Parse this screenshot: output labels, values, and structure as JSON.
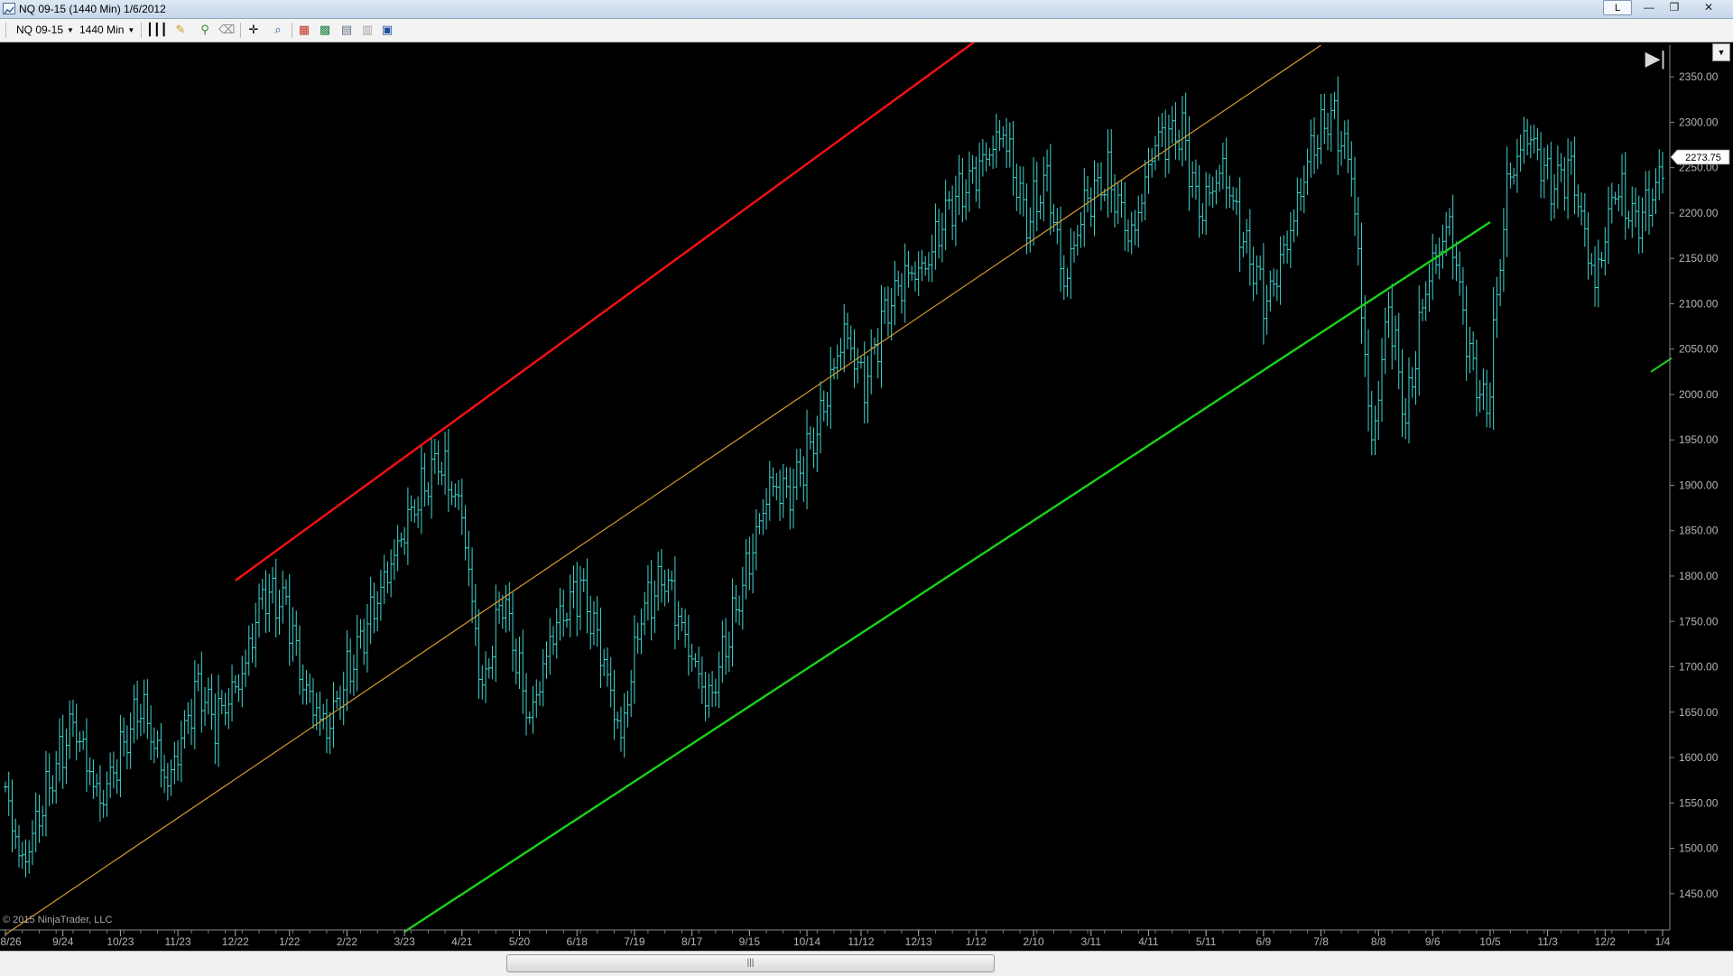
{
  "window": {
    "title": "NQ 09-15 (1440 Min)  1/6/2012",
    "link_label": "L",
    "minimize_glyph": "—",
    "maximize_glyph": "❐",
    "close_glyph": "✕"
  },
  "toolbar": {
    "instrument": "NQ 09-15",
    "interval": "1440 Min",
    "icons": [
      "bar-type-icon",
      "drawing-pencil-icon",
      "draw-tool-icon",
      "eraser-icon",
      "crosshair-icon",
      "zoom-icon",
      "data-box-icon",
      "chart-properties-icon",
      "strategies-icon",
      "indicators-icon",
      "chart-trader-icon"
    ]
  },
  "chart": {
    "copyright": "© 2015 NinjaTrader, LLC",
    "last_price_label": "2273.75",
    "scroll_end_glyph": "▶|",
    "menu_caret": "▼",
    "scroll_thumb_glyph": "|||",
    "colors": {
      "background": "#000000",
      "bars": "#3fd6d0",
      "red_line": "#ff1010",
      "orange_line": "#d89a2e",
      "green_line": "#19d219",
      "axis_text": "#b4b4b4"
    }
  },
  "chart_data": {
    "type": "ohlc-bar",
    "symbol": "NQ 09-15",
    "interval": "1440 Min",
    "y_ticks": [
      "1450.00",
      "1500.00",
      "1550.00",
      "1600.00",
      "1650.00",
      "1700.00",
      "1750.00",
      "1800.00",
      "1850.00",
      "1900.00",
      "1950.00",
      "2000.00",
      "2050.00",
      "2100.00",
      "2150.00",
      "2200.00",
      "2250.00",
      "2300.00",
      "2350.00"
    ],
    "x_ticks": [
      "8/26",
      "9/24",
      "10/23",
      "11/23",
      "12/22",
      "1/22",
      "2/22",
      "3/23",
      "4/21",
      "5/20",
      "6/18",
      "7/19",
      "8/17",
      "9/15",
      "10/14",
      "11/12",
      "12/13",
      "1/12",
      "2/10",
      "3/11",
      "4/11",
      "5/11",
      "6/9",
      "7/8",
      "8/8",
      "9/6",
      "10/5",
      "11/3",
      "12/2",
      "1/4"
    ],
    "ylim": [
      1410,
      2385
    ],
    "last_price": 2273.75,
    "anchors": [
      [
        0,
        1560
      ],
      [
        5,
        1480
      ],
      [
        12,
        1560
      ],
      [
        20,
        1640
      ],
      [
        28,
        1550
      ],
      [
        40,
        1660
      ],
      [
        48,
        1570
      ],
      [
        57,
        1680
      ],
      [
        62,
        1640
      ],
      [
        70,
        1690
      ],
      [
        76,
        1780
      ],
      [
        83,
        1770
      ],
      [
        88,
        1680
      ],
      [
        95,
        1630
      ],
      [
        102,
        1700
      ],
      [
        110,
        1775
      ],
      [
        120,
        1870
      ],
      [
        128,
        1930
      ],
      [
        135,
        1870
      ],
      [
        141,
        1670
      ],
      [
        147,
        1780
      ],
      [
        155,
        1640
      ],
      [
        162,
        1740
      ],
      [
        170,
        1790
      ],
      [
        176,
        1720
      ],
      [
        182,
        1620
      ],
      [
        188,
        1760
      ],
      [
        195,
        1800
      ],
      [
        202,
        1720
      ],
      [
        208,
        1660
      ],
      [
        218,
        1790
      ],
      [
        226,
        1900
      ],
      [
        232,
        1890
      ],
      [
        240,
        1960
      ],
      [
        248,
        2070
      ],
      [
        254,
        2010
      ],
      [
        260,
        2090
      ],
      [
        266,
        2130
      ],
      [
        272,
        2140
      ],
      [
        278,
        2200
      ],
      [
        286,
        2240
      ],
      [
        295,
        2290
      ],
      [
        302,
        2190
      ],
      [
        308,
        2240
      ],
      [
        313,
        2120
      ],
      [
        319,
        2210
      ],
      [
        326,
        2240
      ],
      [
        333,
        2170
      ],
      [
        340,
        2280
      ],
      [
        348,
        2290
      ],
      [
        353,
        2200
      ],
      [
        360,
        2250
      ],
      [
        366,
        2170
      ],
      [
        373,
        2100
      ],
      [
        380,
        2180
      ],
      [
        386,
        2270
      ],
      [
        392,
        2310
      ],
      [
        398,
        2250
      ],
      [
        404,
        1940
      ],
      [
        409,
        2100
      ],
      [
        414,
        1970
      ],
      [
        420,
        2120
      ],
      [
        427,
        2190
      ],
      [
        433,
        2040
      ],
      [
        438,
        1980
      ],
      [
        444,
        2230
      ],
      [
        450,
        2290
      ],
      [
        457,
        2230
      ],
      [
        463,
        2250
      ],
      [
        470,
        2120
      ],
      [
        476,
        2230
      ],
      [
        482,
        2190
      ],
      [
        486,
        2210
      ],
      [
        490,
        2250
      ]
    ],
    "trendlines": [
      {
        "name": "upper-red",
        "from": [
          "12/22",
          1795
        ],
        "to": [
          "1/12",
          2390
        ]
      },
      {
        "name": "middle-orange",
        "from": [
          "8/26",
          1405
        ],
        "to": [
          "7/8",
          2385
        ]
      },
      {
        "name": "lower-green",
        "from": [
          "3/23",
          1408
        ],
        "to": [
          "10/5",
          2190
        ]
      }
    ]
  }
}
